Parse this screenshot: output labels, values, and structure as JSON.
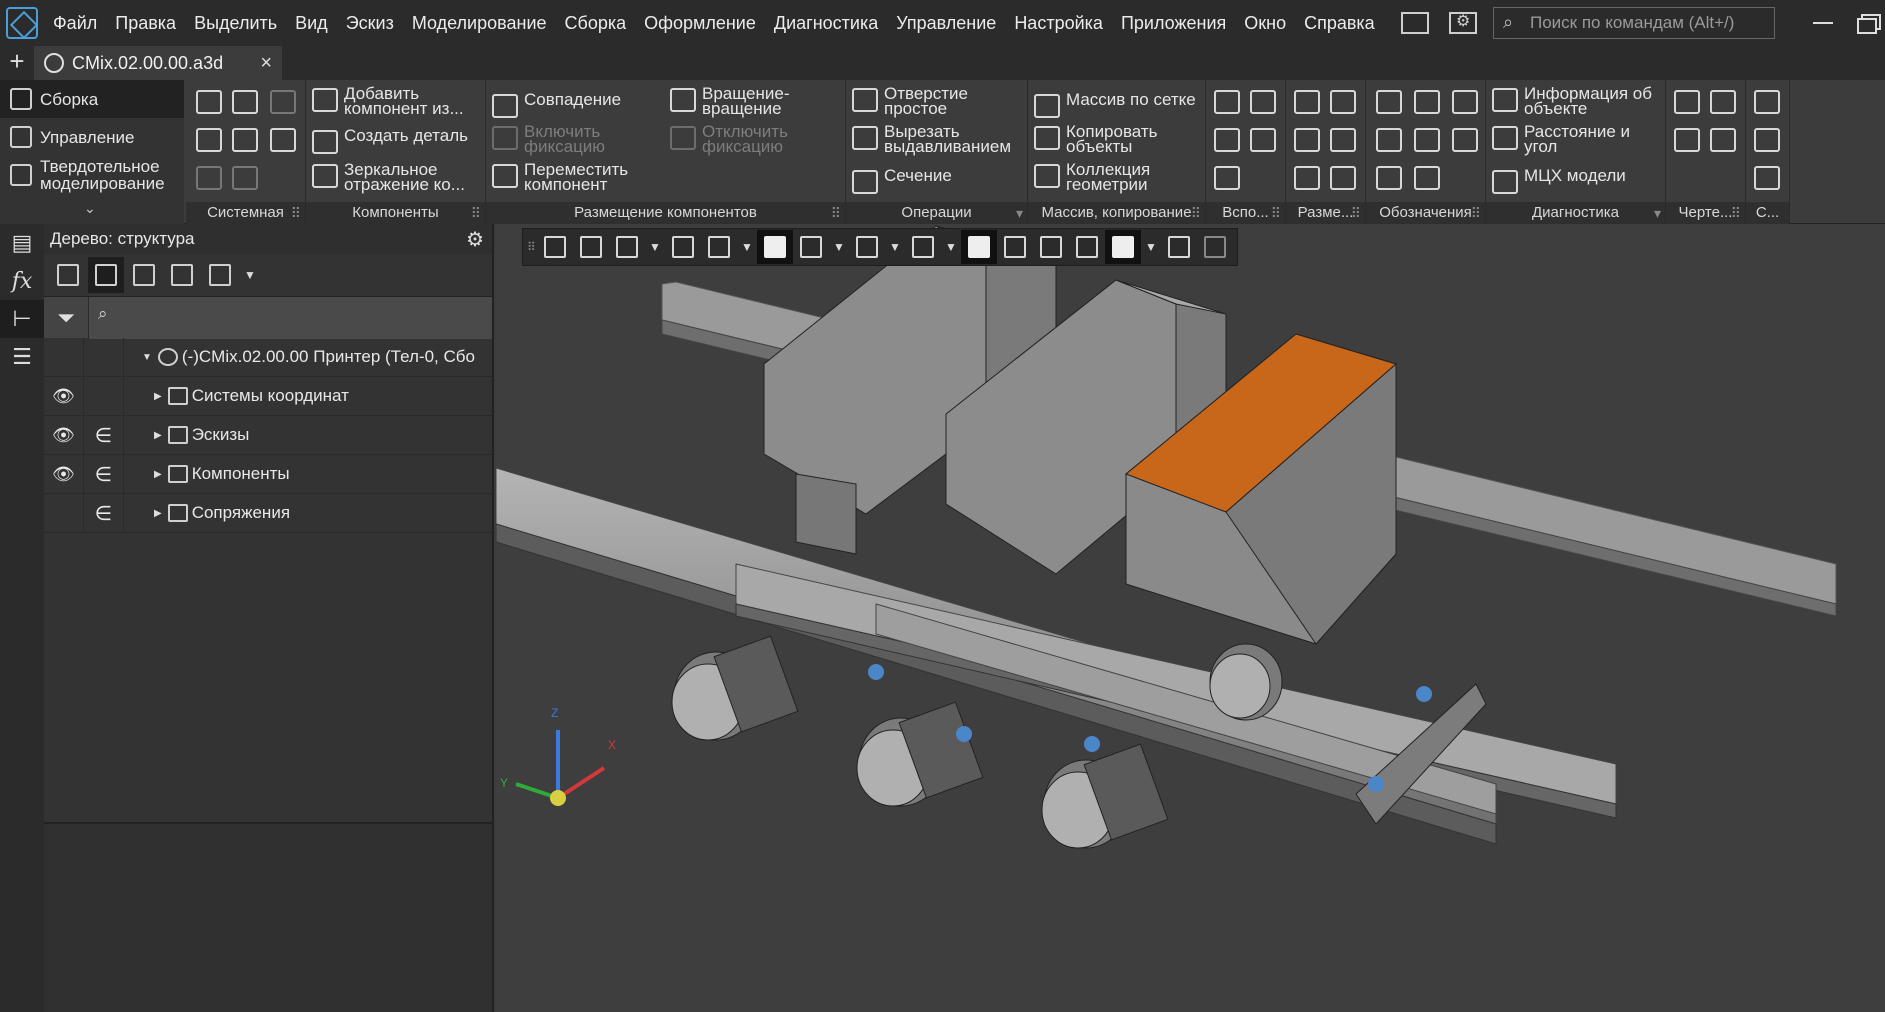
{
  "colors": {
    "accent": "#4a9fd8",
    "highlight_part": "#c8661a",
    "metal": "#8a8a8a",
    "viewport_bg": "#3e3e3e"
  },
  "menu": {
    "items": [
      "Файл",
      "Правка",
      "Выделить",
      "Вид",
      "Эскиз",
      "Моделирование",
      "Сборка",
      "Оформление",
      "Диагностика",
      "Управление",
      "Настройка",
      "Приложения",
      "Окно",
      "Справка"
    ],
    "search_placeholder": "Поиск по командам (Alt+/)"
  },
  "document_tab": {
    "title": "CMix.02.00.00.a3d",
    "close": "×",
    "new": "+"
  },
  "ribbon": {
    "tabs": [
      "Сборка",
      "Управление",
      "Твердотельное\nмоделирование"
    ],
    "collapse": "⌄",
    "groups": {
      "system": "Системная",
      "components": "Компоненты",
      "placement": "Размещение компонентов",
      "operations": "Операции",
      "array": "Массив, копирование",
      "aux": "Вспо...",
      "dims": "Разме...",
      "notation": "Обозначения",
      "diagnostics": "Диагностика",
      "drawing": "Черте...",
      "c": "С..."
    },
    "buttons": {
      "add_component": "Добавить\nкомпонент из...",
      "create_part": "Создать деталь",
      "mirror": "Зеркальное\nотражение ко...",
      "coincidence": "Совпадение",
      "rotation": "Вращение-\nвращение",
      "enable_fix": "Включить\nфиксацию",
      "disable_fix": "Отключить\nфиксацию",
      "move_component": "Переместить\nкомпонент",
      "simple_hole": "Отверстие\nпростое",
      "extrude_cut": "Вырезать\nвыдавливанием",
      "section": "Сечение",
      "grid_array": "Массив по сетке",
      "copy_objects": "Копировать\nобъекты",
      "geometry_collection": "Коллекция\nгеометрии",
      "object_info": "Информация об\nобъекте",
      "distance_angle": "Расстояние и\nугол",
      "mass_props": "МЦХ модели"
    }
  },
  "left_strip": {
    "icons": [
      "properties-icon",
      "variables-icon",
      "tree-icon",
      "layers-icon"
    ],
    "fx": "fx"
  },
  "tree": {
    "header": "Дерево: структура",
    "search_value": "",
    "root": "(-)CMix.02.00.00 Принтер (Тел-0, Сбо",
    "items": [
      {
        "label": "Системы координат",
        "visible": true,
        "included": false
      },
      {
        "label": "Эскизы",
        "visible": true,
        "included": true
      },
      {
        "label": "Компоненты",
        "visible": true,
        "included": true
      },
      {
        "label": "Сопряжения",
        "visible": false,
        "included": true
      }
    ],
    "eye_glyph": "👁",
    "include_glyph": "∈"
  },
  "axes": {
    "x": "X",
    "y": "Y",
    "z": "Z"
  }
}
